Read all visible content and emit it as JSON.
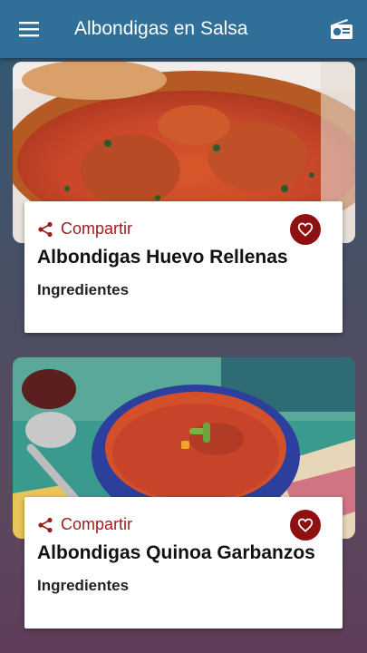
{
  "app_bar": {
    "title": "Albondigas en Salsa",
    "menu_icon": "hamburger-menu-icon",
    "radio_icon": "radio-icon"
  },
  "recipes": [
    {
      "share_label": "Compartir",
      "title": "Albondigas Huevo Rellenas",
      "subtitle": "Ingredientes",
      "image": "meatballs-in-tomato-sauce-photo"
    },
    {
      "share_label": "Compartir",
      "title": "Albondigas Quinoa Garbanzos",
      "subtitle": "Ingredientes",
      "image": "tomato-soup-bowl-photo"
    }
  ],
  "colors": {
    "app_bar": "#2f6f98",
    "accent": "#9b1c1c",
    "fav_button": "#8e1010"
  }
}
